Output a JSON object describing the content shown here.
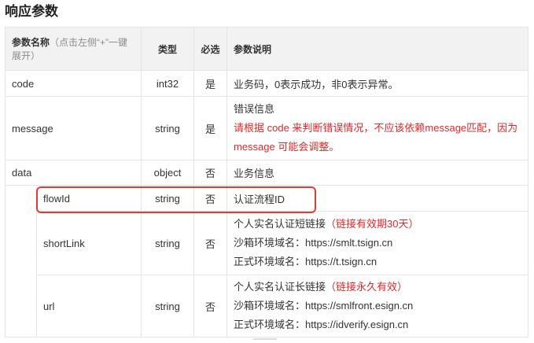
{
  "section_title": "响应参数",
  "table": {
    "headers": {
      "name_main": "参数名称",
      "name_hint": "（点击左侧“+”一键展开）",
      "type": "类型",
      "required": "必选",
      "desc": "参数说明"
    },
    "rows": {
      "code": {
        "name": "code",
        "type": "int32",
        "required": "是",
        "desc": "业务码，0表示成功，非0表示异常。"
      },
      "message": {
        "name": "message",
        "type": "string",
        "required": "是",
        "desc_line1": "错误信息",
        "desc_line2": "请根据 code 来判断错误情况，不应该依赖message匹配，因为",
        "desc_line3": "message 可能会调整。"
      },
      "data": {
        "name": "data",
        "type": "object",
        "required": "否",
        "desc": "业务信息"
      },
      "flowId": {
        "name": "flowId",
        "type": "string",
        "required": "否",
        "desc": "认证流程ID"
      },
      "shortLink": {
        "name": "shortLink",
        "type": "string",
        "required": "否",
        "desc_main": "个人实名认证短链接",
        "desc_note": "（链接有效期30天）",
        "desc_line2": "沙箱环境域名：https://smlt.tsign.cn",
        "desc_line3": "正式环境域名：https://t.tsign.cn"
      },
      "url": {
        "name": "url",
        "type": "string",
        "required": "否",
        "desc_main": "个人实名认证长链接",
        "desc_note": "（链接永久有效）",
        "desc_line2": "沙箱环境域名：https://smlfront.esign.cn",
        "desc_line3": "正式环境域名：https://idverify.esign.cn"
      }
    }
  },
  "colors": {
    "accent_red": "#e0292b",
    "header_bg": "#f2f2f2",
    "border": "#e4e4e4",
    "highlight": "#e53935"
  }
}
